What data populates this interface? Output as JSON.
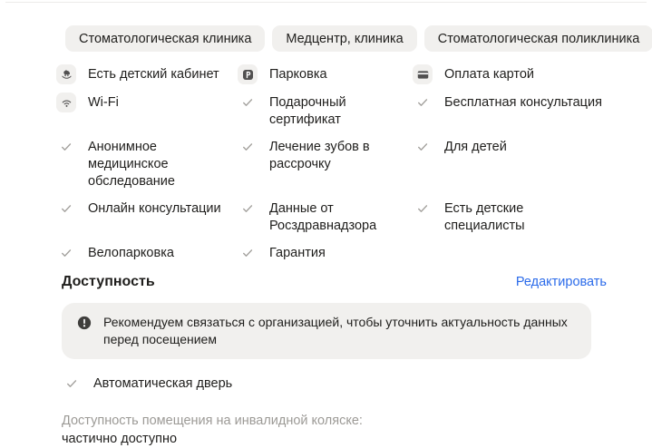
{
  "categories": [
    {
      "label": "Стоматологическая клиника"
    },
    {
      "label": "Медцентр, клиника"
    },
    {
      "label": "Стоматологическая поликлиника"
    }
  ],
  "features": [
    {
      "label": "Есть детский кабинет",
      "icon": "rocking-horse"
    },
    {
      "label": "Парковка",
      "icon": "parking"
    },
    {
      "label": "Оплата картой",
      "icon": "card"
    },
    {
      "label": "Wi-Fi",
      "icon": "wifi"
    },
    {
      "label": "Подарочный сертификат",
      "icon": "check"
    },
    {
      "label": "Бесплатная консультация",
      "icon": "check"
    },
    {
      "label": "Анонимное медицинское обследование",
      "icon": "check"
    },
    {
      "label": "Лечение зубов в рассрочку",
      "icon": "check"
    },
    {
      "label": "Для детей",
      "icon": "check"
    },
    {
      "label": "Онлайн консультации",
      "icon": "check"
    },
    {
      "label": "Данные от Росздравнадзора",
      "icon": "check"
    },
    {
      "label": "Есть детские специалисты",
      "icon": "check"
    },
    {
      "label": "Велопарковка",
      "icon": "check"
    },
    {
      "label": "Гарантия",
      "icon": "check"
    }
  ],
  "accessibility": {
    "title": "Доступность",
    "edit_label": "Редактировать",
    "notice": "Рекомендуем связаться с организацией, чтобы уточнить актуальность данных перед посещением",
    "features": [
      {
        "label": "Автоматическая дверь",
        "icon": "check"
      }
    ],
    "wheelchair_label": "Доступность помещения на инвалидной коляске: ",
    "wheelchair_value": "частично доступно"
  },
  "colors": {
    "accent_link": "#2b6bea",
    "chip_background": "#f1f0ee",
    "text": "#1f1e1c",
    "muted_text": "#9c9a96",
    "icon_glyph": "#515050",
    "check": "#a3a19d"
  }
}
